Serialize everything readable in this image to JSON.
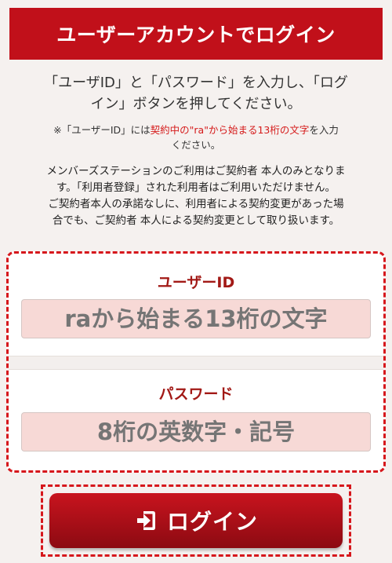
{
  "header": {
    "title": "ユーザーアカウントでログイン"
  },
  "intro": {
    "line1": "「ユーザID」と「パスワード」を入力し、「ログ",
    "line2": "イン」ボタンを押してください。"
  },
  "note": {
    "prefix": "※「ユーザーID」には",
    "highlight": "契約中の\"ra\"から始まる13桁の文字",
    "suffix": "を入力",
    "line2": "ください。"
  },
  "policy": {
    "line1": "メンバーズステーションのご利用はご契約者 本人のみとなりま",
    "line2": "す。「利用者登録」された利用者はご利用いただけません。",
    "line3": "ご契約者本人の承諾なしに、利用者による契約変更があった場",
    "line4": "合でも、ご契約者 本人による契約変更として取り扱います。"
  },
  "form": {
    "user_label": "ユーザーID",
    "user_placeholder": "raから始まる13桁の文字",
    "password_label": "パスワード",
    "password_placeholder": "8桁の英数字・記号"
  },
  "login_button": {
    "label": "ログイン",
    "icon": "login-icon"
  },
  "colors": {
    "brand_red": "#c1101a",
    "label_red": "#a21916",
    "input_bg": "#f7d9d6",
    "input_text": "#b8591c",
    "highlight_red": "#d51a1a"
  }
}
